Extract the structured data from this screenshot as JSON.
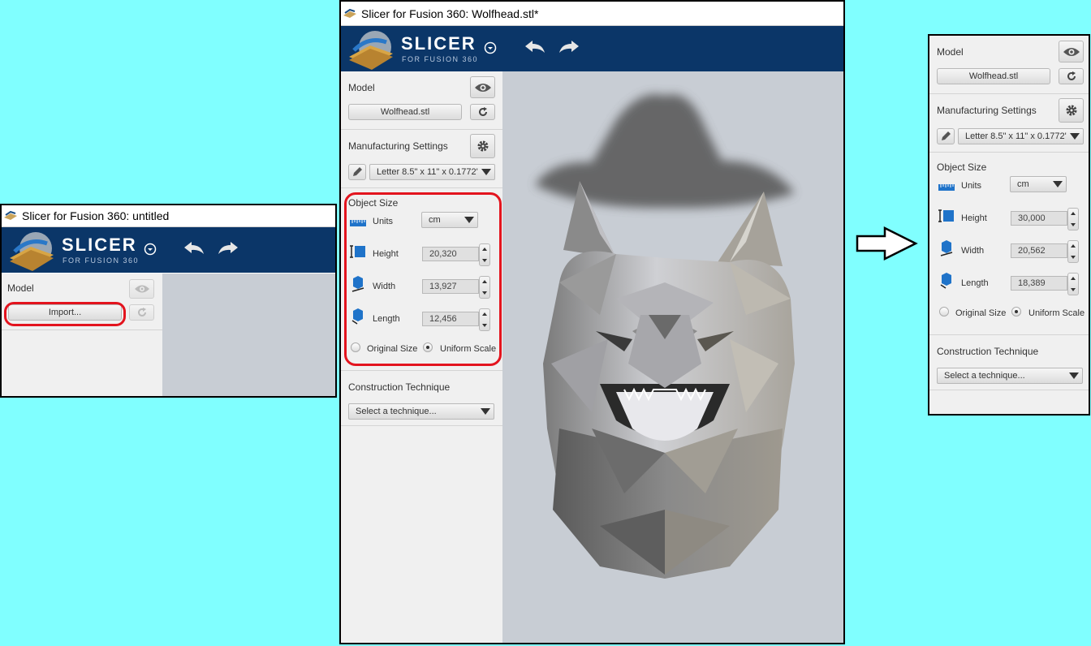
{
  "app_name": "SLICER",
  "app_subtitle": "FOR FUSION 360",
  "left_window": {
    "title": "Slicer for Fusion 360: untitled",
    "model_label": "Model",
    "import_button": "Import..."
  },
  "center_window": {
    "title": "Slicer for Fusion 360: Wolfhead.stl*",
    "model_label": "Model",
    "model_file": "Wolfhead.stl",
    "manufacturing_label": "Manufacturing Settings",
    "manufacturing_value": "Letter 8.5\" x 11\" x 0.1772'",
    "object_size_label": "Object Size",
    "units_label": "Units",
    "units_value": "cm",
    "height_label": "Height",
    "height_value": "20,320",
    "width_label": "Width",
    "width_value": "13,927",
    "length_label": "Length",
    "length_value": "12,456",
    "original_size_label": "Original Size",
    "uniform_scale_label": "Uniform Scale",
    "construction_label": "Construction Technique",
    "technique_placeholder": "Select a technique..."
  },
  "right_window": {
    "model_label": "Model",
    "model_file": "Wolfhead.stl",
    "manufacturing_label": "Manufacturing Settings",
    "manufacturing_value": "Letter 8.5\" x 11\" x 0.1772'",
    "object_size_label": "Object Size",
    "units_label": "Units",
    "units_value": "cm",
    "height_label": "Height",
    "height_value": "30,000",
    "width_label": "Width",
    "width_value": "20,562",
    "length_label": "Length",
    "length_value": "18,389",
    "original_size_label": "Original Size",
    "uniform_scale_label": "Uniform Scale",
    "construction_label": "Construction Technique",
    "technique_placeholder": "Select a technique..."
  },
  "colors": {
    "background": "#80ffff",
    "header": "#0b3668",
    "highlight": "#e3141e",
    "panel": "#f0f0f0",
    "viewport": "#c8cdd4"
  },
  "icons": [
    "app-icon",
    "slicer-logo",
    "dropdown-circle-icon",
    "undo-icon",
    "redo-icon",
    "eye-icon",
    "refresh-icon",
    "gear-icon",
    "pencil-icon",
    "ruler-icon",
    "height-icon",
    "width-icon",
    "length-icon",
    "arrow-right-icon"
  ]
}
